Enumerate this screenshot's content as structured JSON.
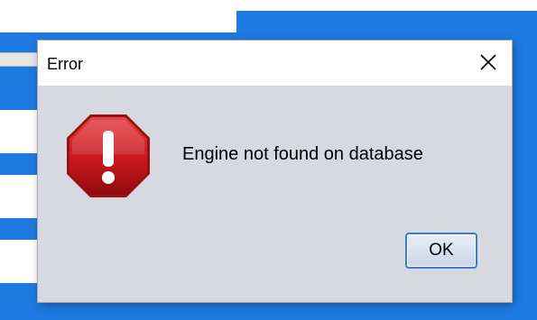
{
  "dialog": {
    "title": "Error",
    "message": "Engine not found on database",
    "ok_label": "OK",
    "icon": "error-stop-icon",
    "close_icon": "close-icon"
  },
  "colors": {
    "desktop_background": "#1e7ae0",
    "dialog_body": "#d6d9df",
    "titlebar": "#ffffff",
    "error_icon": "#c8161d",
    "button_border": "#3d7cc9"
  }
}
